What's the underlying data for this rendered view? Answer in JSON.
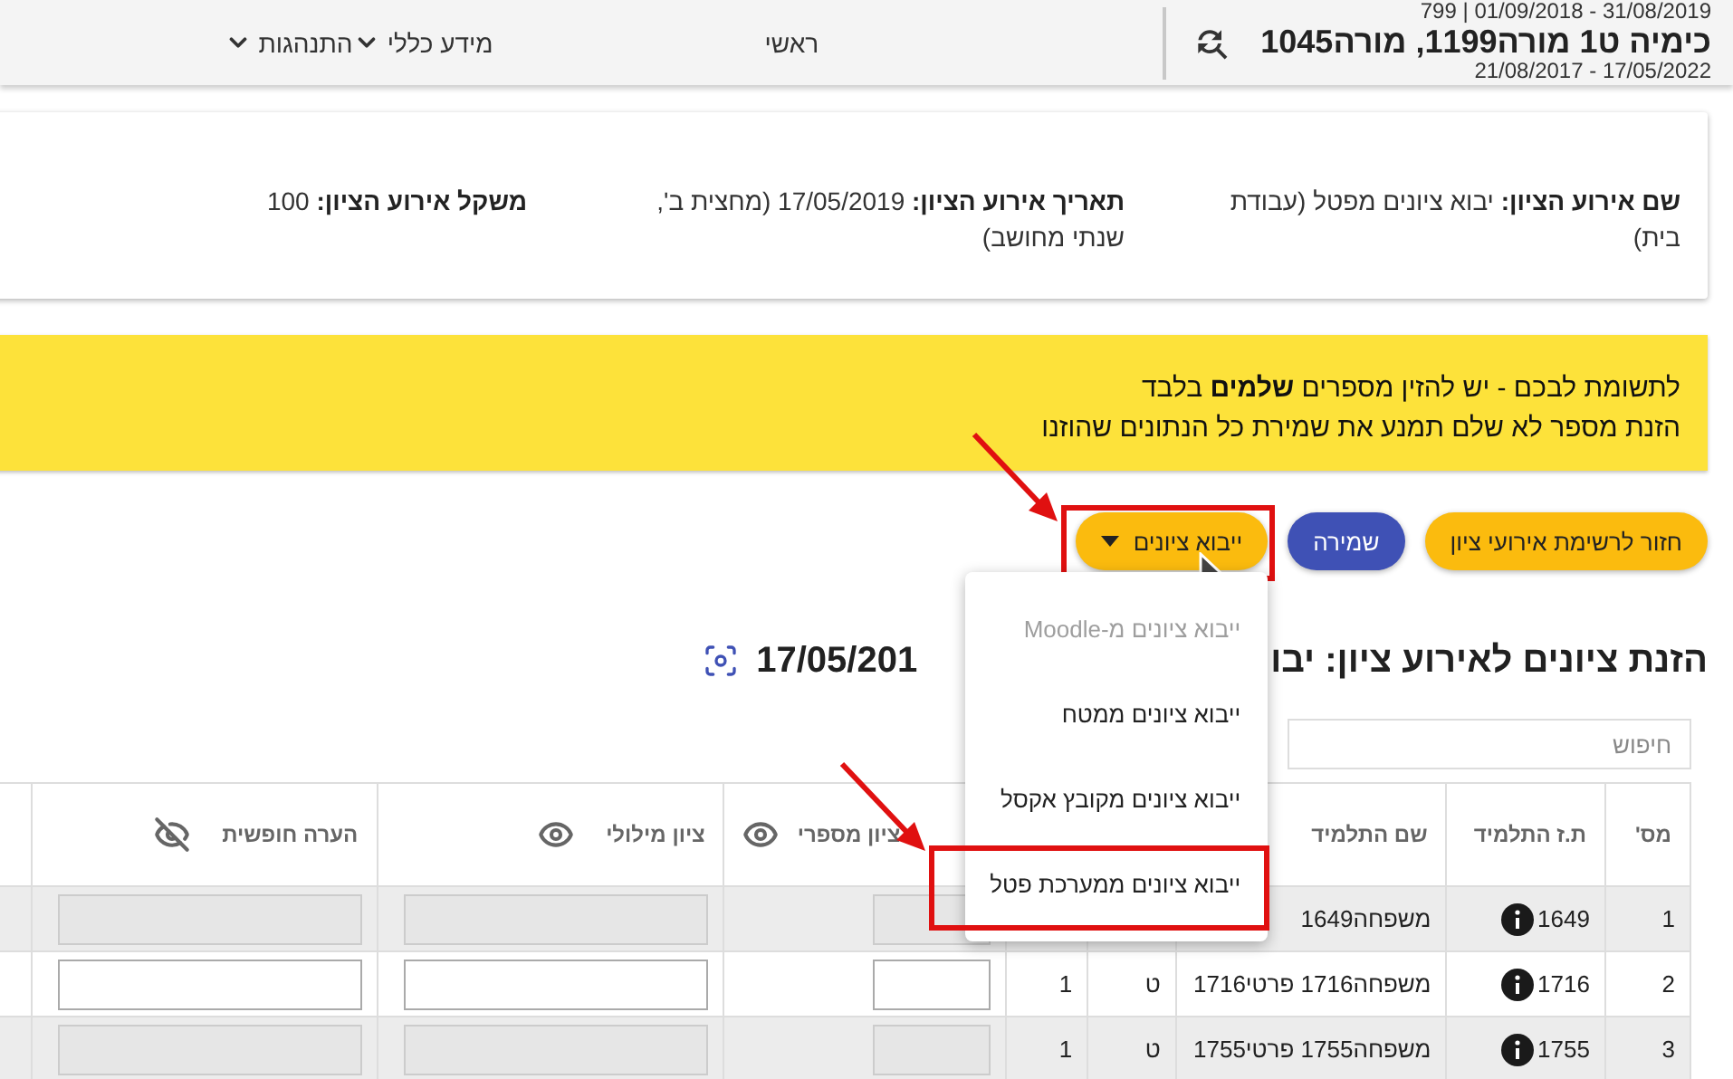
{
  "header": {
    "period": "31/08/2019 - 01/09/2018 | 799",
    "course": "כימיה ט1 מורה1199, מורה1045",
    "dates": "17/05/2022 - 21/08/2017",
    "nav": [
      {
        "label": "ראשי",
        "dropdown": false
      },
      {
        "label": "מידע כללי",
        "dropdown": true
      },
      {
        "label": "התנהגות",
        "dropdown": true
      }
    ]
  },
  "event_info": [
    {
      "label": "שם אירוע הציון:",
      "value": "יבוא ציונים מפטל (עבודת בית)"
    },
    {
      "label": "תאריך אירוע הציון:",
      "value": "17/05/2019 (מחצית ב', שנתי מחושב)"
    },
    {
      "label": "משקל אירוע הציון:",
      "value": "100"
    }
  ],
  "notice": [
    "לתשומת לבכם - יש להזין מספרים **שלמים** בלבד",
    "הזנת מספר לא שלם תמנע את שמירת כל הנתונים שהוזנו"
  ],
  "buttons": [
    {
      "label": "חזור לרשימת אירועי ציון",
      "kind": "back",
      "highlighted": false
    },
    {
      "label": "שמירה",
      "kind": "save",
      "highlighted": false
    },
    {
      "label": "ייבוא ציונים",
      "kind": "import",
      "highlighted": true
    }
  ],
  "import_menu": [
    {
      "label": "ייבוא ציונים מ-Moodle",
      "disabled": true,
      "highlighted": false
    },
    {
      "label": "ייבוא ציונים ממטח",
      "disabled": false,
      "highlighted": false
    },
    {
      "label": "ייבוא ציונים מקובץ אקסל",
      "disabled": false,
      "highlighted": false
    },
    {
      "label": "ייבוא ציונים ממערכת פטל",
      "disabled": false,
      "highlighted": true
    }
  ],
  "heading": "הזנת ציונים לאירוע ציון: יבו",
  "heading_date": "17/05/201",
  "search": {
    "placeholder": "חיפוש"
  },
  "table": {
    "columns": [
      {
        "label": "מס'",
        "kind": "text"
      },
      {
        "label": "ת.ז התלמיד",
        "kind": "text"
      },
      {
        "label": "שם התלמיד",
        "kind": "text"
      },
      {
        "kind": "text"
      },
      {
        "kind": "text"
      },
      {
        "label": "ציון מספרי",
        "kind": "input",
        "visible": true
      },
      {
        "label": "ציון מילולי",
        "kind": "input",
        "visible": true
      },
      {
        "label": "הערה חופשית",
        "kind": "input",
        "visible": false
      }
    ],
    "rows": [
      {
        "cells": [
          "1",
          "1649",
          "משפחה1649"
        ],
        "disabled": true
      },
      {
        "cells": [
          "2",
          "1716",
          "משפחה1716 פרטי1716",
          "ט",
          "1"
        ],
        "disabled": false
      },
      {
        "cells": [
          "3",
          "1755",
          "משפחה1755 פרטי1755",
          "ט",
          "1"
        ],
        "disabled": true
      }
    ]
  }
}
